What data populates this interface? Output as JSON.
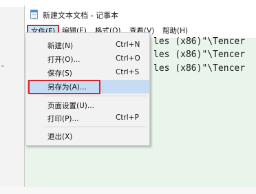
{
  "window": {
    "title": "新建文本文档 - 记事本"
  },
  "menubar": {
    "file": "文件(F)",
    "edit": "编辑(E)",
    "format": "格式(O)",
    "view": "查看(V)",
    "help": "帮助(H)"
  },
  "editor": {
    "lines": [
      "les (x86)\"\\Tencer",
      "les (x86)\"\\Tencer",
      "les (x86)\"\\Tencer"
    ]
  },
  "file_menu": {
    "new": {
      "label": "新建(N)",
      "shortcut": "Ctrl+N"
    },
    "open": {
      "label": "打开(O)...",
      "shortcut": "Ctrl+O"
    },
    "save": {
      "label": "保存(S)",
      "shortcut": "Ctrl+S"
    },
    "save_as": {
      "label": "另存为(A)..."
    },
    "page_setup": {
      "label": "页面设置(U)..."
    },
    "print": {
      "label": "打印(P)...",
      "shortcut": "Ctrl+P"
    },
    "exit": {
      "label": "退出(X)"
    }
  },
  "colors": {
    "highlight_box": "#d9222a",
    "editor_background": "#e9f4ea",
    "menu_hover": "#c6dcf2"
  }
}
